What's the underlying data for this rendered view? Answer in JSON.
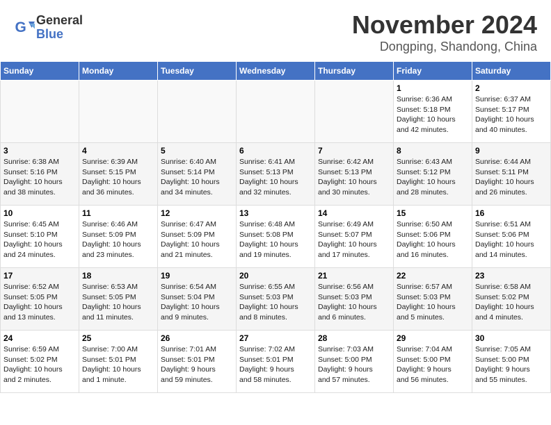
{
  "header": {
    "logo_general": "General",
    "logo_blue": "Blue",
    "month_title": "November 2024",
    "location": "Dongping, Shandong, China"
  },
  "days_of_week": [
    "Sunday",
    "Monday",
    "Tuesday",
    "Wednesday",
    "Thursday",
    "Friday",
    "Saturday"
  ],
  "weeks": [
    [
      {
        "day": "",
        "info": ""
      },
      {
        "day": "",
        "info": ""
      },
      {
        "day": "",
        "info": ""
      },
      {
        "day": "",
        "info": ""
      },
      {
        "day": "",
        "info": ""
      },
      {
        "day": "1",
        "info": "Sunrise: 6:36 AM\nSunset: 5:18 PM\nDaylight: 10 hours\nand 42 minutes."
      },
      {
        "day": "2",
        "info": "Sunrise: 6:37 AM\nSunset: 5:17 PM\nDaylight: 10 hours\nand 40 minutes."
      }
    ],
    [
      {
        "day": "3",
        "info": "Sunrise: 6:38 AM\nSunset: 5:16 PM\nDaylight: 10 hours\nand 38 minutes."
      },
      {
        "day": "4",
        "info": "Sunrise: 6:39 AM\nSunset: 5:15 PM\nDaylight: 10 hours\nand 36 minutes."
      },
      {
        "day": "5",
        "info": "Sunrise: 6:40 AM\nSunset: 5:14 PM\nDaylight: 10 hours\nand 34 minutes."
      },
      {
        "day": "6",
        "info": "Sunrise: 6:41 AM\nSunset: 5:13 PM\nDaylight: 10 hours\nand 32 minutes."
      },
      {
        "day": "7",
        "info": "Sunrise: 6:42 AM\nSunset: 5:13 PM\nDaylight: 10 hours\nand 30 minutes."
      },
      {
        "day": "8",
        "info": "Sunrise: 6:43 AM\nSunset: 5:12 PM\nDaylight: 10 hours\nand 28 minutes."
      },
      {
        "day": "9",
        "info": "Sunrise: 6:44 AM\nSunset: 5:11 PM\nDaylight: 10 hours\nand 26 minutes."
      }
    ],
    [
      {
        "day": "10",
        "info": "Sunrise: 6:45 AM\nSunset: 5:10 PM\nDaylight: 10 hours\nand 24 minutes."
      },
      {
        "day": "11",
        "info": "Sunrise: 6:46 AM\nSunset: 5:09 PM\nDaylight: 10 hours\nand 23 minutes."
      },
      {
        "day": "12",
        "info": "Sunrise: 6:47 AM\nSunset: 5:09 PM\nDaylight: 10 hours\nand 21 minutes."
      },
      {
        "day": "13",
        "info": "Sunrise: 6:48 AM\nSunset: 5:08 PM\nDaylight: 10 hours\nand 19 minutes."
      },
      {
        "day": "14",
        "info": "Sunrise: 6:49 AM\nSunset: 5:07 PM\nDaylight: 10 hours\nand 17 minutes."
      },
      {
        "day": "15",
        "info": "Sunrise: 6:50 AM\nSunset: 5:06 PM\nDaylight: 10 hours\nand 16 minutes."
      },
      {
        "day": "16",
        "info": "Sunrise: 6:51 AM\nSunset: 5:06 PM\nDaylight: 10 hours\nand 14 minutes."
      }
    ],
    [
      {
        "day": "17",
        "info": "Sunrise: 6:52 AM\nSunset: 5:05 PM\nDaylight: 10 hours\nand 13 minutes."
      },
      {
        "day": "18",
        "info": "Sunrise: 6:53 AM\nSunset: 5:05 PM\nDaylight: 10 hours\nand 11 minutes."
      },
      {
        "day": "19",
        "info": "Sunrise: 6:54 AM\nSunset: 5:04 PM\nDaylight: 10 hours\nand 9 minutes."
      },
      {
        "day": "20",
        "info": "Sunrise: 6:55 AM\nSunset: 5:03 PM\nDaylight: 10 hours\nand 8 minutes."
      },
      {
        "day": "21",
        "info": "Sunrise: 6:56 AM\nSunset: 5:03 PM\nDaylight: 10 hours\nand 6 minutes."
      },
      {
        "day": "22",
        "info": "Sunrise: 6:57 AM\nSunset: 5:03 PM\nDaylight: 10 hours\nand 5 minutes."
      },
      {
        "day": "23",
        "info": "Sunrise: 6:58 AM\nSunset: 5:02 PM\nDaylight: 10 hours\nand 4 minutes."
      }
    ],
    [
      {
        "day": "24",
        "info": "Sunrise: 6:59 AM\nSunset: 5:02 PM\nDaylight: 10 hours\nand 2 minutes."
      },
      {
        "day": "25",
        "info": "Sunrise: 7:00 AM\nSunset: 5:01 PM\nDaylight: 10 hours\nand 1 minute."
      },
      {
        "day": "26",
        "info": "Sunrise: 7:01 AM\nSunset: 5:01 PM\nDaylight: 9 hours\nand 59 minutes."
      },
      {
        "day": "27",
        "info": "Sunrise: 7:02 AM\nSunset: 5:01 PM\nDaylight: 9 hours\nand 58 minutes."
      },
      {
        "day": "28",
        "info": "Sunrise: 7:03 AM\nSunset: 5:00 PM\nDaylight: 9 hours\nand 57 minutes."
      },
      {
        "day": "29",
        "info": "Sunrise: 7:04 AM\nSunset: 5:00 PM\nDaylight: 9 hours\nand 56 minutes."
      },
      {
        "day": "30",
        "info": "Sunrise: 7:05 AM\nSunset: 5:00 PM\nDaylight: 9 hours\nand 55 minutes."
      }
    ]
  ]
}
